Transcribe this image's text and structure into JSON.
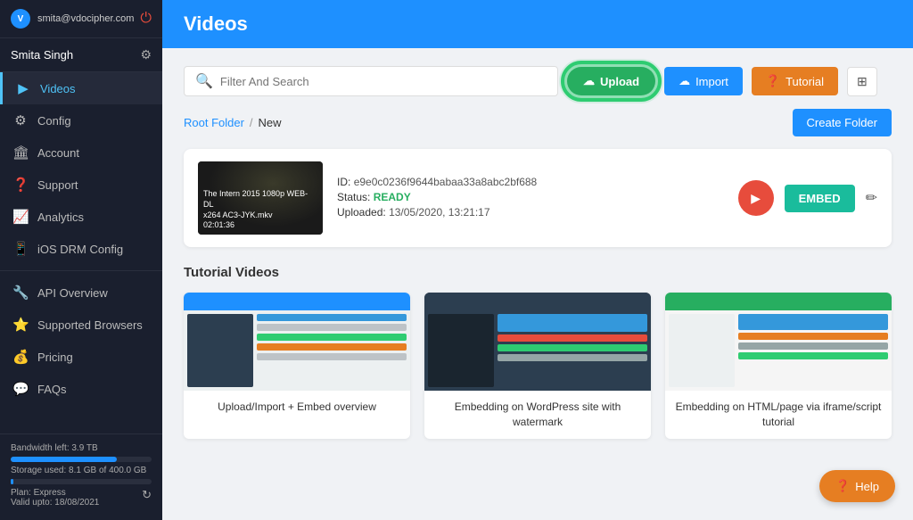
{
  "sidebar": {
    "email": "smita@vdocipher.com",
    "user_name": "Smita Singh",
    "nav_items": [
      {
        "id": "videos",
        "label": "Videos",
        "icon": "▶",
        "active": true
      },
      {
        "id": "config",
        "label": "Config",
        "icon": "⚙"
      },
      {
        "id": "account",
        "label": "Account",
        "icon": "🏛"
      },
      {
        "id": "support",
        "label": "Support",
        "icon": "❓"
      },
      {
        "id": "analytics",
        "label": "Analytics",
        "icon": "📈"
      },
      {
        "id": "ios-drm",
        "label": "iOS DRM Config",
        "icon": "📱"
      },
      {
        "id": "api-overview",
        "label": "API Overview",
        "icon": "🔧"
      },
      {
        "id": "supported-browsers",
        "label": "Supported Browsers",
        "icon": "⭐"
      },
      {
        "id": "pricing",
        "label": "Pricing",
        "icon": "💰"
      },
      {
        "id": "faqs",
        "label": "FAQs",
        "icon": "💬"
      }
    ],
    "footer": {
      "bandwidth": "Bandwidth left: 3.9 TB",
      "storage": "Storage used: 8.1 GB of 400.0 GB",
      "storage_percent": 2,
      "bandwidth_percent": 75,
      "plan": "Plan: Express",
      "valid": "Valid upto: 18/08/2021"
    }
  },
  "header": {
    "title": "Videos"
  },
  "toolbar": {
    "search_placeholder": "Filter And Search",
    "upload_label": "Upload",
    "import_label": "Import",
    "tutorial_label": "Tutorial"
  },
  "breadcrumb": {
    "root": "Root Folder",
    "separator": "/",
    "current": "New",
    "create_folder_label": "Create Folder"
  },
  "video": {
    "id": "e9e0c0236f9644babaa33a8abc2bf688",
    "status": "READY",
    "uploaded": "13/05/2020, 13:21:17",
    "title_line1": "The Intern 2015 1080p WEB-DL",
    "title_line2": "x264 AC3-JYK.mkv",
    "duration": "02:01:36",
    "id_label": "ID:",
    "status_label": "Status:",
    "uploaded_label": "Uploaded:",
    "embed_label": "EMBED"
  },
  "tutorial_section": {
    "heading": "Tutorial Videos",
    "cards": [
      {
        "label": "Upload/Import + Embed overview"
      },
      {
        "label": "Embedding on WordPress site with watermark"
      },
      {
        "label": "Embedding on HTML/page via iframe/script tutorial"
      }
    ]
  },
  "help": {
    "label": "Help"
  }
}
